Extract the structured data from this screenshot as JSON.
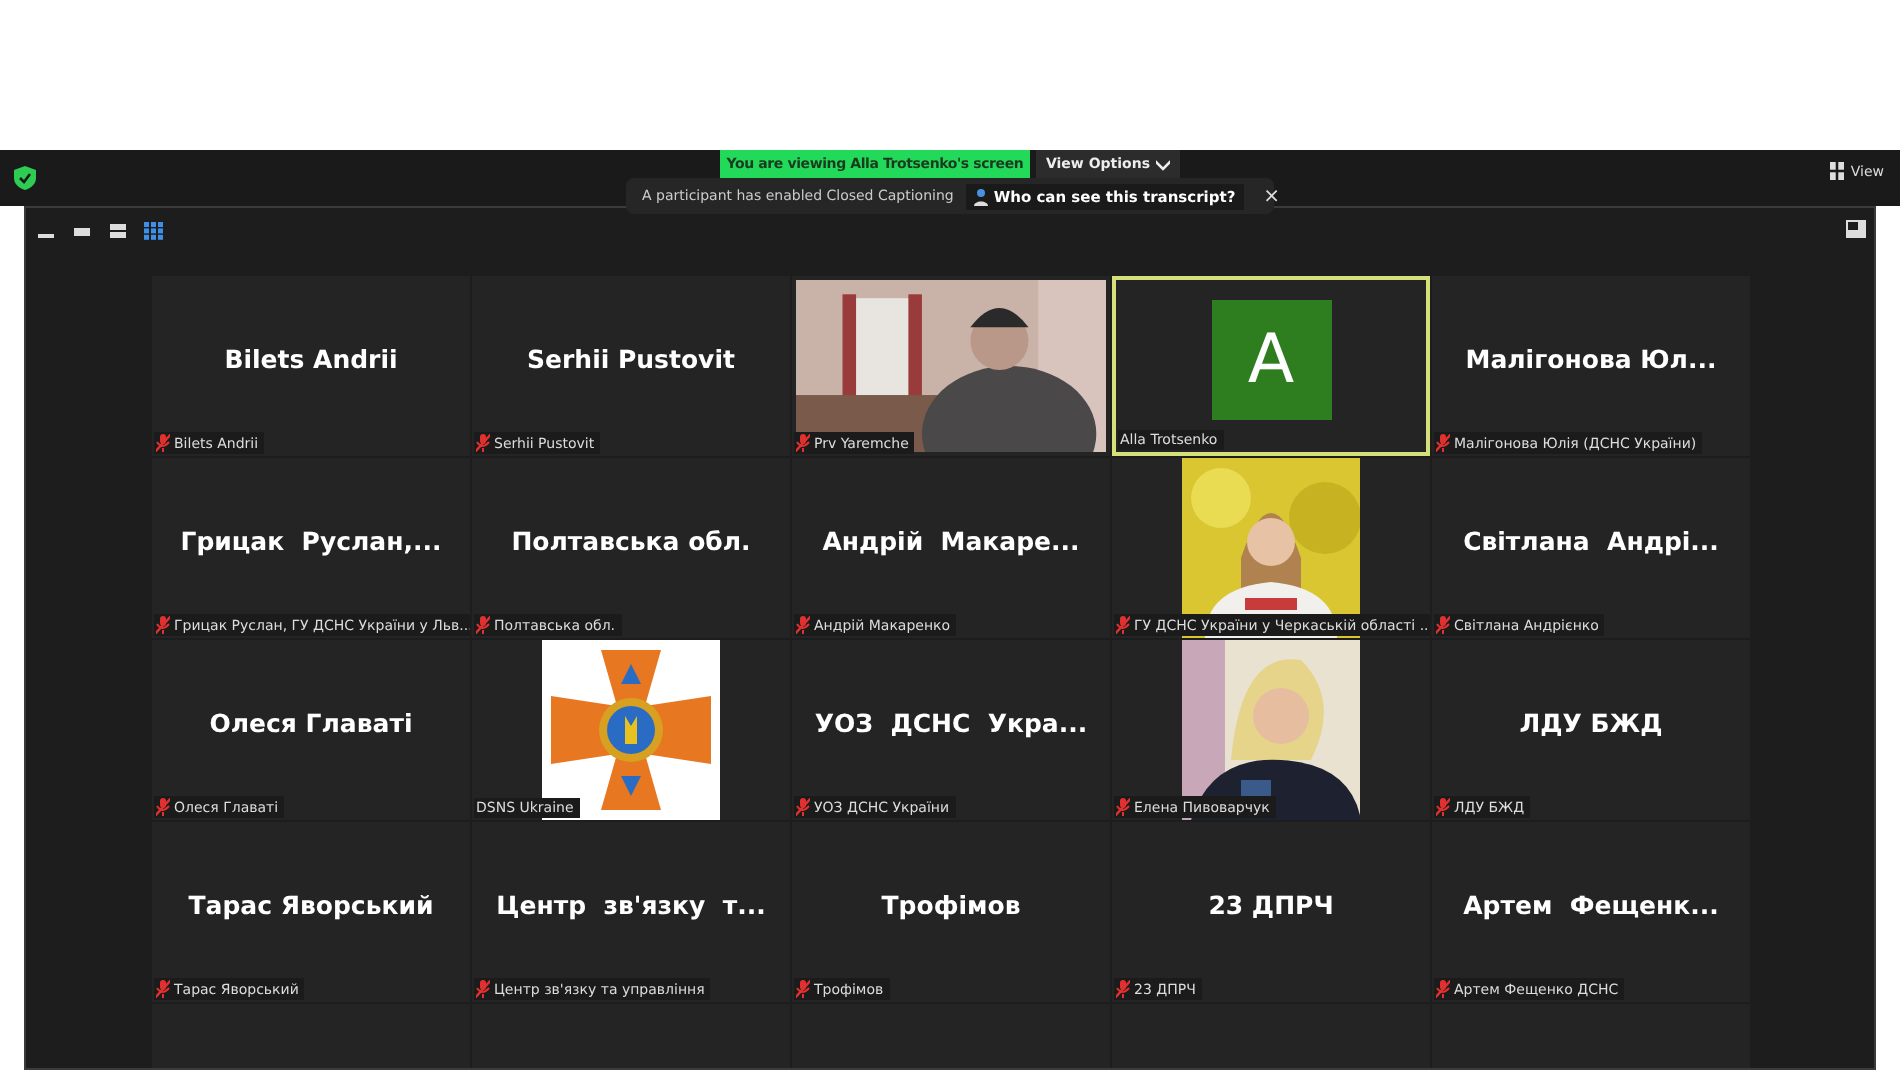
{
  "top_bar": {
    "share_banner": "You are viewing Alla Trotsenko's screen",
    "view_options": "View Options",
    "view_button": "View"
  },
  "caption_notice": {
    "message": "A participant has enabled Closed Captioning",
    "link": "Who can see this transcript?",
    "close": "×"
  },
  "tiles": [
    {
      "kind": "name",
      "title": "Bilets Andrii",
      "caption": "Bilets Andrii",
      "muted": true,
      "active_speaker": false
    },
    {
      "kind": "name",
      "title": "Serhii Pustovit",
      "caption": "Serhii Pustovit",
      "muted": true,
      "active_speaker": false
    },
    {
      "kind": "video",
      "caption": "Prv Yaremche",
      "muted": true,
      "active_speaker": false
    },
    {
      "kind": "avatar",
      "letter": "A",
      "caption": "Alla Trotsenko",
      "muted": false,
      "active_speaker": true
    },
    {
      "kind": "name",
      "title": "Малігонова Юл...",
      "caption": "Малігонова Юлія (ДСНС України)",
      "muted": true,
      "active_speaker": false
    },
    {
      "kind": "name",
      "title": "Грицак  Руслан,...",
      "caption": "Грицак Руслан, ГУ ДСНС України у Льв...",
      "muted": true,
      "active_speaker": false
    },
    {
      "kind": "name",
      "title": "Полтавська обл.",
      "caption": "Полтавська обл.",
      "muted": true,
      "active_speaker": false
    },
    {
      "kind": "name",
      "title": "Андрій  Макаре...",
      "caption": "Андрій Макаренко",
      "muted": true,
      "active_speaker": false
    },
    {
      "caption": "ГУ ДСНС України у Черкаській області ...",
      "muted": true,
      "active_speaker": false
    },
    {
      "kind": "name",
      "title": "Світлана  Андрі...",
      "caption": "Світлана Андрієнко",
      "muted": true,
      "active_speaker": false
    },
    {
      "kind": "name",
      "title": "Олеся Главаті",
      "caption": "Олеся Главаті",
      "muted": true,
      "active_speaker": false
    },
    {
      "kind": "emblem",
      "caption": "DSNS Ukraine",
      "muted": false,
      "active_speaker": false
    },
    {
      "kind": "name",
      "title": "УОЗ  ДСНС  Укра...",
      "caption": "УОЗ ДСНС України",
      "muted": true,
      "active_speaker": false
    },
    {
      "caption": "Елена Пивоварчук",
      "muted": true,
      "active_speaker": false
    },
    {
      "kind": "name",
      "title": "ЛДУ БЖД",
      "caption": "ЛДУ БЖД",
      "muted": true,
      "active_speaker": false
    },
    {
      "kind": "name",
      "title": "Тарас Яворський",
      "caption": "Тарас Яворський",
      "muted": true,
      "active_speaker": false
    },
    {
      "kind": "name",
      "title": "Центр  зв'язку  т...",
      "caption": "Центр зв'язку та управління",
      "muted": true,
      "active_speaker": false
    },
    {
      "kind": "name",
      "title": "Трофімов",
      "caption": "Трофімов",
      "muted": true,
      "active_speaker": false
    },
    {
      "kind": "name",
      "title": "23 ДПРЧ",
      "caption": "23 ДПРЧ",
      "muted": true,
      "active_speaker": false
    },
    {
      "kind": "name",
      "title": "Артем  Фещенк...",
      "caption": "Артем Фещенко ДСНС",
      "muted": true,
      "active_speaker": false
    },
    {
      "kind": "blank"
    },
    {
      "kind": "blank"
    },
    {
      "kind": "blank"
    },
    {
      "kind": "blank"
    },
    {
      "kind": "blank"
    }
  ]
}
